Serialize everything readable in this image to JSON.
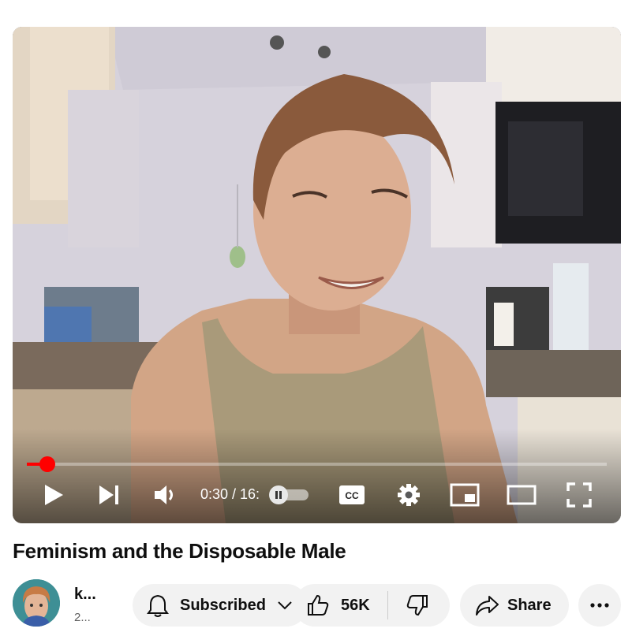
{
  "player": {
    "time_display": "0:30 / 16:",
    "progress_fraction": 0.035,
    "colors": {
      "progress": "#ff0000"
    },
    "icons": [
      "play-icon",
      "next-icon",
      "volume-icon",
      "pause-icon",
      "closed-captions-icon",
      "settings-icon",
      "miniplayer-icon",
      "theater-mode-icon",
      "fullscreen-icon"
    ]
  },
  "video": {
    "title": "Feminism and the Disposable Male"
  },
  "channel": {
    "name": "k...",
    "subscribers": "2..."
  },
  "actions": {
    "subscribe_label": "Subscribed",
    "like_count": "56K",
    "share_label": "Share"
  }
}
